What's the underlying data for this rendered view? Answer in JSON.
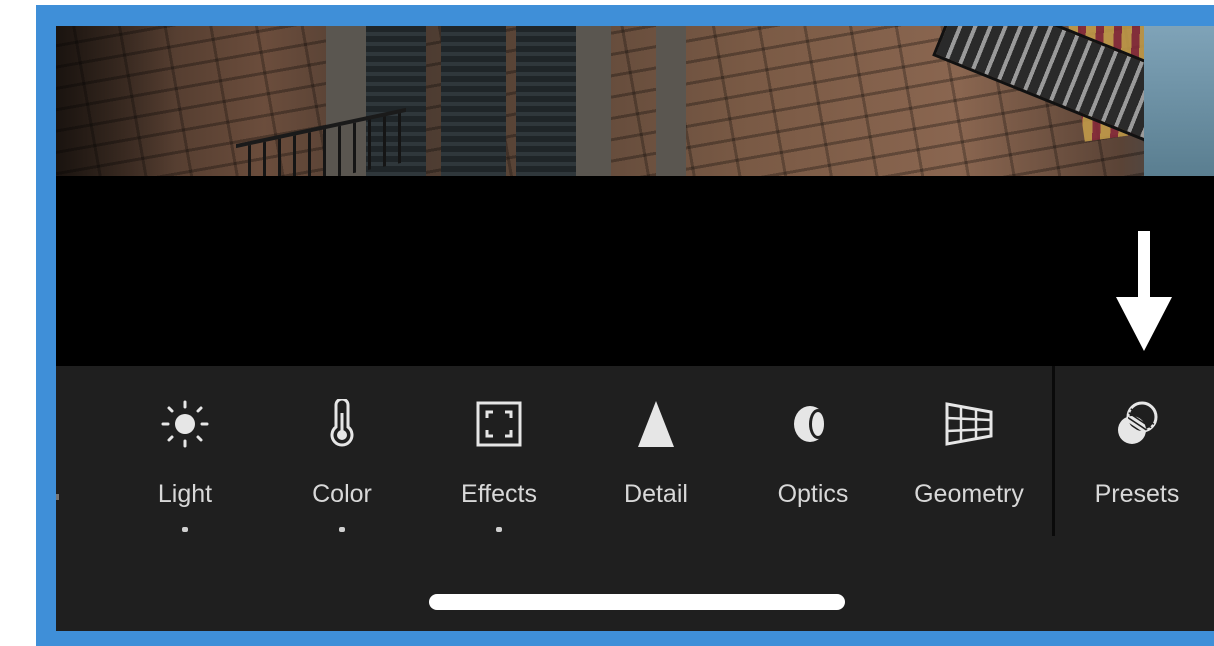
{
  "toolbar": {
    "tools": [
      {
        "label": "Light",
        "icon": "sun-icon",
        "indicator": true
      },
      {
        "label": "Color",
        "icon": "thermometer-icon",
        "indicator": true
      },
      {
        "label": "Effects",
        "icon": "vignette-frame-icon",
        "indicator": true
      },
      {
        "label": "Detail",
        "icon": "triangle-icon",
        "indicator": false
      },
      {
        "label": "Optics",
        "icon": "lens-icon",
        "indicator": false
      },
      {
        "label": "Geometry",
        "icon": "grid-perspective-icon",
        "indicator": false
      },
      {
        "label": "Presets",
        "icon": "presets-overlap-icon",
        "indicator": false
      }
    ]
  },
  "annotation": {
    "icon": "down-arrow-icon",
    "color": "#ffffff"
  },
  "colors": {
    "frame_border": "#3f8fd8",
    "toolbar_bg": "#1f1f1f",
    "label_text": "#d8d8d8"
  }
}
